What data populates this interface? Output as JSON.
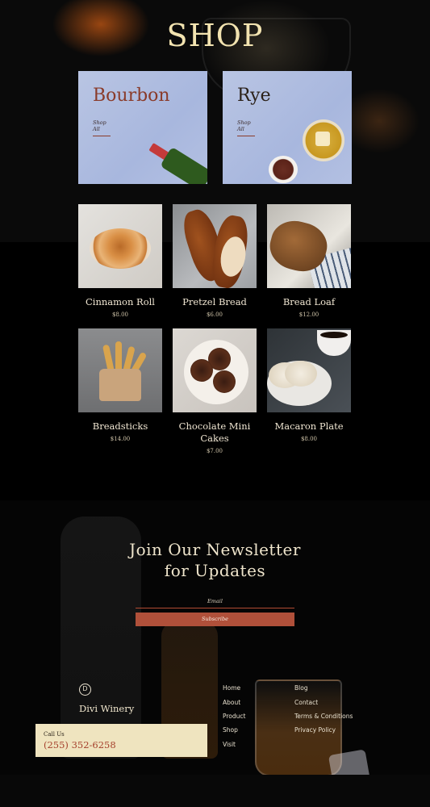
{
  "shop": {
    "title": "SHOP",
    "categories": [
      {
        "name": "Bourbon",
        "link": "Shop All"
      },
      {
        "name": "Rye",
        "link": "Shop All"
      }
    ],
    "products": [
      {
        "name": "Cinnamon Roll",
        "price": "$8.00"
      },
      {
        "name": "Pretzel Bread",
        "price": "$6.00"
      },
      {
        "name": "Bread Loaf",
        "price": "$12.00"
      },
      {
        "name": "Breadsticks",
        "price": "$14.00"
      },
      {
        "name": "Chocolate Mini Cakes",
        "price": "$7.00"
      },
      {
        "name": "Macaron Plate",
        "price": "$8.00"
      }
    ]
  },
  "newsletter": {
    "title_line1": "Join Our Newsletter",
    "title_line2": "for Updates",
    "email_label": "Email",
    "subscribe_label": "Subscribe"
  },
  "footer": {
    "logo_letter": "D",
    "brand": "Divi Winery",
    "call_label": "Call Us",
    "phone": "(255) 352-6258",
    "links_col1": [
      "Home",
      "About",
      "Product",
      "Shop",
      "Visit"
    ],
    "links_col2": [
      "Blog",
      "Contact",
      "Terms & Conditions",
      "Privacy Policy"
    ]
  },
  "colors": {
    "accent": "#b0503a",
    "cream": "#efe4bf",
    "category_bg": "#b3c0e2",
    "background": "#000000"
  }
}
